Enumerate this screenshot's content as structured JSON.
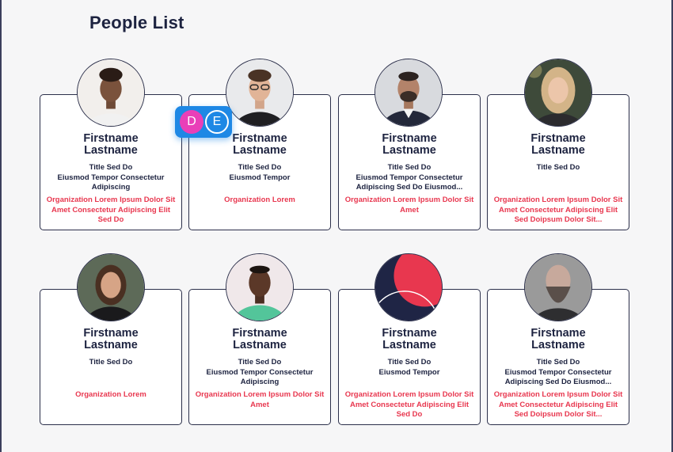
{
  "page": {
    "title": "People List"
  },
  "presence": {
    "users": [
      "D",
      "E"
    ]
  },
  "people": [
    {
      "first": "Firstname",
      "last": "Lastname",
      "title": "Title Sed Do\nEiusmod Tempor Consectetur Adipiscing",
      "org": "Organization Lorem Ipsum Dolor Sit Amet Consectetur Adipiscing Elit Sed Do"
    },
    {
      "first": "Firstname",
      "last": "Lastname",
      "title": "Title Sed Do\nEiusmod Tempor",
      "org": "Organization Lorem"
    },
    {
      "first": "Firstname",
      "last": "Lastname",
      "title": "Title Sed Do\nEiusmod Tempor Consectetur Adipiscing Sed Do Eiusmod...",
      "org": "Organization Lorem Ipsum Dolor Sit Amet"
    },
    {
      "first": "Firstname",
      "last": "Lastname",
      "title": "Title Sed Do",
      "org": "Organization Lorem Ipsum Dolor Sit Amet Consectetur Adipiscing Elit Sed Doipsum Dolor Sit..."
    },
    {
      "first": "Firstname",
      "last": "Lastname",
      "title": "Title Sed Do",
      "org": "Organization Lorem"
    },
    {
      "first": "Firstname",
      "last": "Lastname",
      "title": "Title Sed Do\nEiusmod Tempor Consectetur Adipiscing",
      "org": "Organization Lorem Ipsum Dolor Sit Amet"
    },
    {
      "first": "Firstname",
      "last": "Lastname",
      "title": "Title Sed Do\nEiusmod Tempor",
      "org": "Organization Lorem Ipsum Dolor Sit Amet Consectetur Adipiscing Elit Sed Do"
    },
    {
      "first": "Firstname",
      "last": "Lastname",
      "title": "Title Sed Do\nEiusmod Tempor Consectetur Adipiscing Sed Do Eiusmod...",
      "org": "Organization Lorem Ipsum Dolor Sit Amet Consectetur Adipiscing Elit Sed Doipsum Dolor Sit..."
    }
  ],
  "colors": {
    "name": "#1d2340",
    "org": "#e8374f",
    "presence": "#1e88e5"
  }
}
